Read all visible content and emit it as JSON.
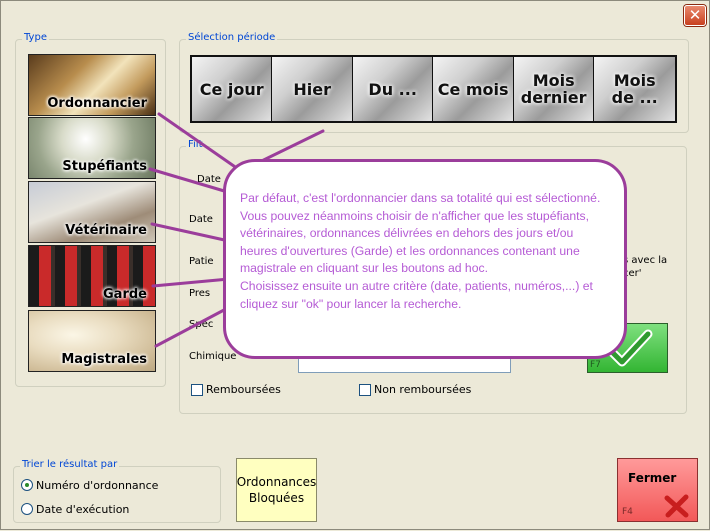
{
  "window": {
    "close_glyph": "✕"
  },
  "type_group": {
    "title": "Type",
    "items": [
      {
        "label": "Ordonnancier"
      },
      {
        "label": "Stupéfiants"
      },
      {
        "label": "Vétérinaire"
      },
      {
        "label": "Garde"
      },
      {
        "label": "Magistrales"
      }
    ]
  },
  "period_group": {
    "title": "Sélection période",
    "buttons": [
      {
        "label": "Ce jour"
      },
      {
        "label": "Hier"
      },
      {
        "label": "Du ..."
      },
      {
        "label": "Ce mois"
      },
      {
        "label": "Mois dernier"
      },
      {
        "label": "Mois de ..."
      }
    ]
  },
  "filters_group": {
    "title_partial": "Filt",
    "labels_partial": [
      "Date",
      "Date",
      "Patie",
      "Pres",
      "Spéc",
      "Chimique"
    ],
    "right_partial": [
      "s avec la",
      "cer'"
    ],
    "checkboxes": [
      {
        "label": "Remboursées",
        "checked": false
      },
      {
        "label": "Non remboursées",
        "checked": false
      }
    ],
    "ok_hint": "F7"
  },
  "callout": {
    "paragraph1": "Par défaut, c'est l'ordonnancier dans sa totalité qui est sélectionné. Vous pouvez néanmoins choisir de n'afficher que les stupéfiants, vétérinaires, ordonnances délivrées en dehors des jours et/ou heures d'ouvertures (Garde) et les ordonnances contenant une magistrale en cliquant sur les boutons ad hoc.",
    "paragraph2": "Choisissez ensuite un autre critère (date, patients, numéros,...) et cliquez sur \"ok\" pour lancer la recherche.",
    "text_color": "#b55bd5",
    "border_color": "#9b3d9b"
  },
  "sort_group": {
    "title": "Trier le résultat par",
    "options": [
      {
        "label": "Numéro d'ordonnance",
        "selected": true
      },
      {
        "label": "Date d'exécution",
        "selected": false
      }
    ]
  },
  "bloquees_button": {
    "line1": "Ordonnances",
    "line2": "Bloquées"
  },
  "fermer_button": {
    "label": "Fermer",
    "key": "F4"
  }
}
